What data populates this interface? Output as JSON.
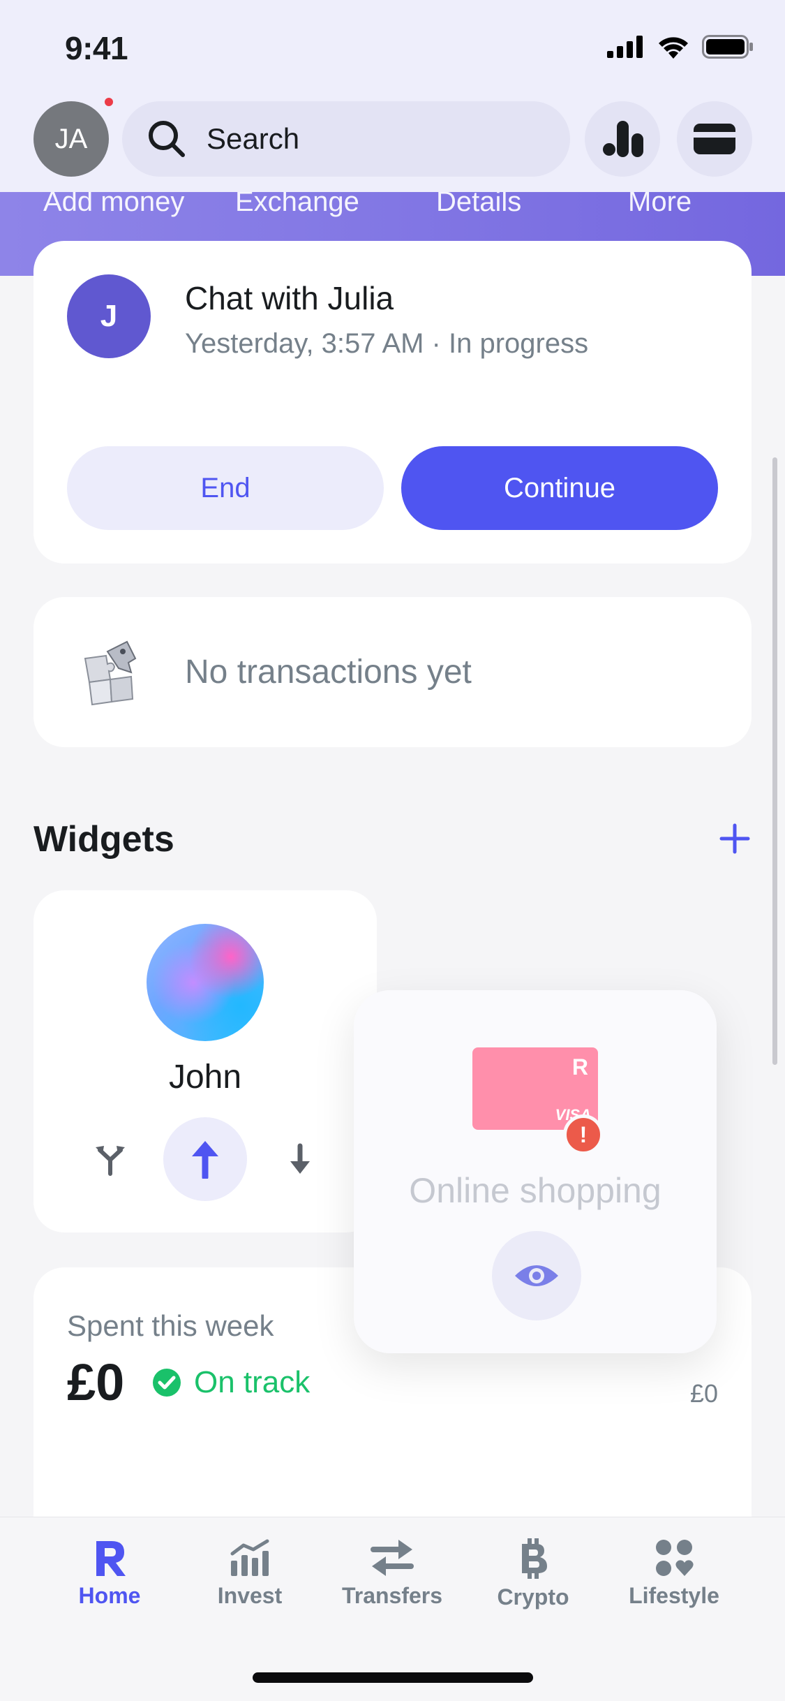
{
  "status_bar": {
    "time": "9:41"
  },
  "header": {
    "avatar_initials": "JA",
    "search_placeholder": "Search"
  },
  "hero_actions": [
    "Add money",
    "Exchange",
    "Details",
    "More"
  ],
  "chat": {
    "avatar_initial": "J",
    "title": "Chat with Julia",
    "subtitle": "Yesterday, 3:57 AM · In progress",
    "end_label": "End",
    "continue_label": "Continue"
  },
  "transactions": {
    "empty_text": "No transactions yet"
  },
  "widgets": {
    "title": "Widgets",
    "contact": {
      "name": "John"
    },
    "shopping": {
      "title": "Online shopping",
      "card_logo": "R",
      "card_brand": "VISA",
      "alert": "!"
    }
  },
  "spent": {
    "label": "Spent this week",
    "amount": "£0",
    "status": "On track",
    "right_value": "£0"
  },
  "tabs": [
    {
      "label": "Home",
      "icon": "revolut-r-icon",
      "active": true
    },
    {
      "label": "Invest",
      "icon": "chart-icon",
      "active": false
    },
    {
      "label": "Transfers",
      "icon": "transfer-arrows-icon",
      "active": false
    },
    {
      "label": "Crypto",
      "icon": "bitcoin-icon",
      "active": false
    },
    {
      "label": "Lifestyle",
      "icon": "lifestyle-icon",
      "active": false
    }
  ],
  "colors": {
    "accent": "#4f55f1",
    "success": "#1ac16a",
    "muted_text": "#75808a",
    "alert": "#ec5a4a"
  }
}
